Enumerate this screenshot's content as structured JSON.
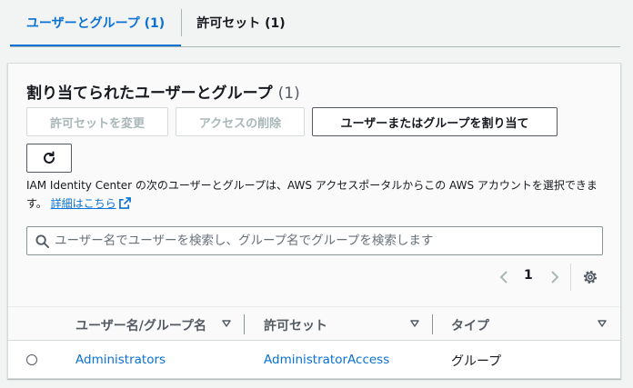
{
  "tabs": [
    {
      "label": "ユーザーとグループ (1)",
      "active": true
    },
    {
      "label": "許可セット (1)",
      "active": false
    }
  ],
  "panel": {
    "title": "割り当てられたユーザーとグループ",
    "count": "(1)",
    "buttons": {
      "change_permission_set": "許可セットを変更",
      "remove_access": "アクセスの削除",
      "assign": "ユーザーまたはグループを割り当て"
    },
    "description": "IAM Identity Center の次のユーザーとグループは、AWS アクセスポータルからこの AWS アカウントを選択できます。",
    "learn_more_link": "詳細はこちら",
    "search": {
      "placeholder": "ユーザー名でユーザーを検索し、グループ名でグループを検索します",
      "value": ""
    },
    "pagination": {
      "current_page": "1"
    }
  },
  "table": {
    "columns": [
      "ユーザー名/グループ名",
      "許可セット",
      "タイプ"
    ],
    "rows": [
      {
        "name": "Administrators",
        "permission_set": "AdministratorAccess",
        "type": "グループ",
        "selected": false
      }
    ]
  },
  "colors": {
    "accent": "#0972d3",
    "text": "#16191f",
    "disabled": "#aab7b8",
    "background": "#f2f3f3"
  },
  "icons": [
    "refresh-icon",
    "external-link-icon",
    "search-icon",
    "chevron-left-icon",
    "chevron-right-icon",
    "settings-gear-icon",
    "sort-caret-icon"
  ]
}
